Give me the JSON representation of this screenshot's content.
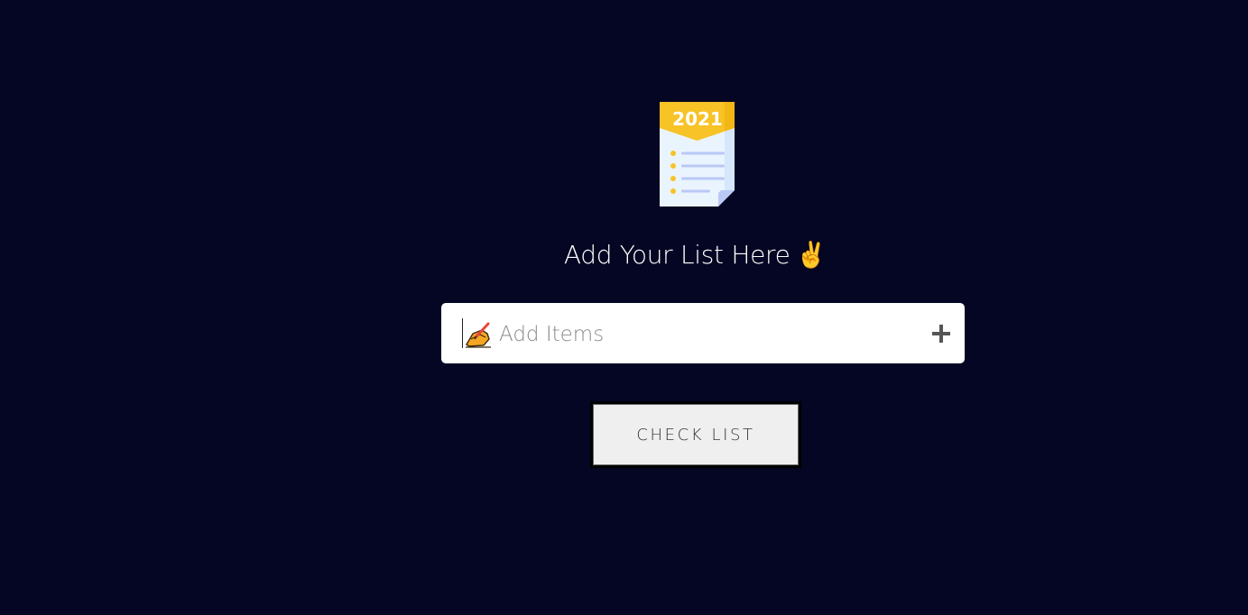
{
  "logo": {
    "icon": "checklist-document-icon",
    "year": "2021",
    "colors": {
      "banner": "#f7c326",
      "paper": "#eaf4ff",
      "lines": "#b9c8f5",
      "bullets": "#f7c326"
    }
  },
  "heading": {
    "text": "Add Your List Here",
    "emoji": "✌"
  },
  "input": {
    "icon": "writing-hand-icon",
    "placeholder": "Add Items",
    "value": ""
  },
  "add_button": {
    "icon": "plus-icon"
  },
  "check_button": {
    "label": "CHECK LIST"
  },
  "colors": {
    "background": "#050623",
    "input_bg": "#ffffff",
    "button_bg": "#efefef"
  }
}
